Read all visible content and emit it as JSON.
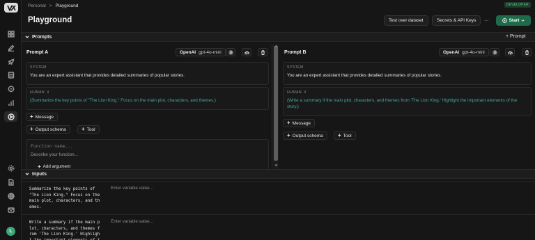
{
  "breadcrumb": {
    "workspace": "Personal",
    "separator": ">",
    "current": "Playground"
  },
  "badge": "DEVELOPER",
  "page_title": "Playground",
  "toolbar": {
    "test_dataset": "Test over dataset",
    "secrets": "Secrets & API Keys",
    "more": "···",
    "start": "Start"
  },
  "prompts_section": {
    "title": "Prompts",
    "add_prompt": "+ Prompt"
  },
  "prompt_a": {
    "title": "Prompt A",
    "provider": "OpenAI",
    "model": "gpt-4o-mini",
    "system_role": "SYSTEM",
    "system_text": "You are an expert assistant that provides detailed summaries of popular stories.",
    "human_role": "HUMAN",
    "human_text": "{Summarize the key points of \"The Lion King.\" Focus on the main plot, characters, and themes.}",
    "add_message": "Message",
    "output_schema": "Output schema",
    "tool": "Tool",
    "function_name_placeholder": "Function name...",
    "function_desc_placeholder": "Describe your function...",
    "add_argument": "Add argument"
  },
  "prompt_b": {
    "title": "Prompt B",
    "provider": "OpenAI",
    "model": "gpt-4o-mini",
    "system_role": "SYSTEM",
    "system_text": "You are an expert assistant that provides detailed summaries of popular stories.",
    "human_role": "HUMAN",
    "human_text": "{Write a summary if the main plot, characters, and themes from 'The Lion King.' Highlight the important elements of the story.}",
    "add_message": "Message",
    "output_schema": "Output schema",
    "tool": "Tool"
  },
  "inputs_section": {
    "title": "Inputs"
  },
  "inputs": [
    {
      "name": "Summarize the key points of\n\"The Lion King.\" Focus on the\nmain plot, characters, and th\nemes.",
      "placeholder": "Enter variable value..."
    },
    {
      "name": "Write a summary if the main p\nlot, characters, and themes f\nrom 'The Lion King.' Highligh\nt the important elements of t",
      "placeholder": "Enter variable value..."
    }
  ],
  "user_initial": "L",
  "colors": {
    "accent": "#1e6b4a",
    "human_text": "#45a7a0",
    "background": "#161616"
  }
}
